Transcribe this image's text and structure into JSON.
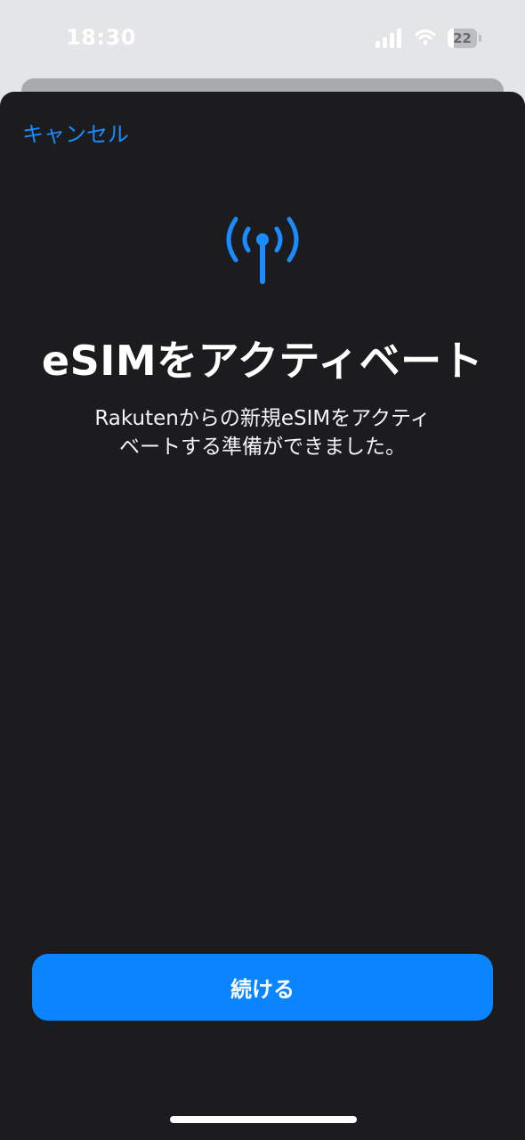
{
  "status_bar": {
    "time": "18:30",
    "battery_level": "22",
    "battery_fraction": 0.22,
    "signal_bars": 4,
    "icons": [
      "signal-icon",
      "wifi-icon",
      "battery-icon"
    ]
  },
  "sheet": {
    "cancel_label": "キャンセル",
    "icon": "antenna-icon",
    "title": "eSIMをアクティベート",
    "description": "Rakutenからの新規eSIMをアクティベートする準備ができました。",
    "continue_label": "続ける"
  },
  "colors": {
    "accent": "#0a84ff",
    "link": "#1a8cff",
    "sheet_background": "#1c1c1e",
    "text": "#ffffff"
  }
}
